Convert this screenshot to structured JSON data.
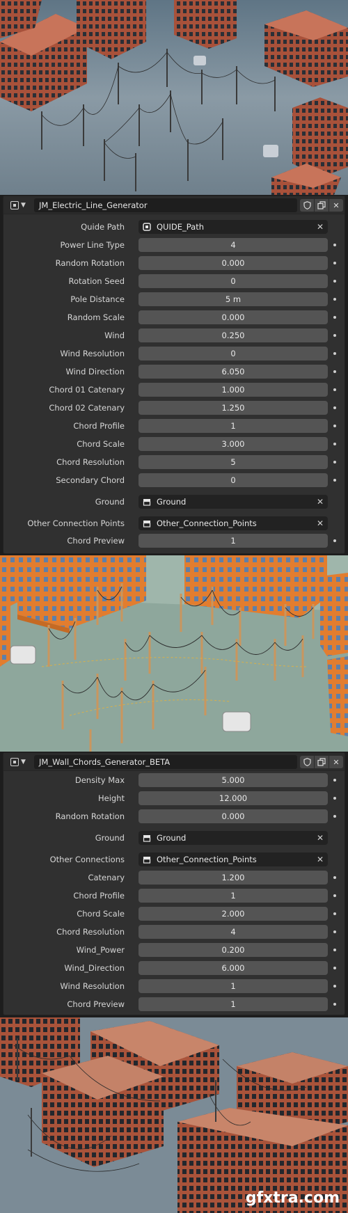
{
  "panel1": {
    "title": "JM_Electric_Line_Generator",
    "rows": [
      {
        "label": "Quide Path",
        "value": "QUIDE_Path",
        "kind": "object-path"
      },
      {
        "label": "Power Line Type",
        "value": "4"
      },
      {
        "label": "Random Rotation",
        "value": "0.000"
      },
      {
        "label": "Rotation Seed",
        "value": "0"
      },
      {
        "label": "Pole Distance",
        "value": "5 m"
      },
      {
        "label": "Random Scale",
        "value": "0.000"
      },
      {
        "label": "Wind",
        "value": "0.250"
      },
      {
        "label": "Wind Resolution",
        "value": "0"
      },
      {
        "label": "Wind Direction",
        "value": "6.050"
      },
      {
        "label": "Chord 01 Catenary",
        "value": "1.000"
      },
      {
        "label": "Chord 02 Catenary",
        "value": "1.250"
      },
      {
        "label": "Chord Profile",
        "value": "1"
      },
      {
        "label": "Chord Scale",
        "value": "3.000"
      },
      {
        "label": "Chord Resolution",
        "value": "5"
      },
      {
        "label": "Secondary Chord",
        "value": "0"
      },
      {
        "label": "Ground",
        "value": "Ground",
        "kind": "object-collection"
      },
      {
        "label": "Other Connection Points",
        "value": "Other_Connection_Points",
        "kind": "object-collection"
      },
      {
        "label": "Chord Preview",
        "value": "1"
      }
    ]
  },
  "panel2": {
    "title": "JM_Wall_Chords_Generator_BETA",
    "rows": [
      {
        "label": "Density Max",
        "value": "5.000"
      },
      {
        "label": "Height",
        "value": "12.000"
      },
      {
        "label": "Random Rotation",
        "value": "0.000"
      },
      {
        "label": "Ground",
        "value": "Ground",
        "kind": "object-collection"
      },
      {
        "label": "Other Connections",
        "value": "Other_Connection_Points",
        "kind": "object-collection"
      },
      {
        "label": "Catenary",
        "value": "1.200"
      },
      {
        "label": "Chord Profile",
        "value": "1"
      },
      {
        "label": "Chord Scale",
        "value": "2.000"
      },
      {
        "label": "Chord Resolution",
        "value": "4"
      },
      {
        "label": "Wind_Power",
        "value": "0.200"
      },
      {
        "label": "Wind_Direction",
        "value": "6.000"
      },
      {
        "label": "Wind Resolution",
        "value": "1"
      },
      {
        "label": "Chord Preview",
        "value": "1"
      }
    ]
  },
  "watermark": "gfxtra.com",
  "icons": {
    "header_type": "geometry-nodes-icon",
    "shield": "fake-user-shield-icon",
    "copy": "duplicate-icon",
    "close": "close-icon",
    "path_field": "curve-object-icon",
    "collection_field": "collection-icon"
  },
  "colors": {
    "panel_bg": "#303030",
    "field_bg": "#545454",
    "object_field_bg": "#222222",
    "brick": "#b0593a",
    "orange_building": "#e07a2e"
  }
}
